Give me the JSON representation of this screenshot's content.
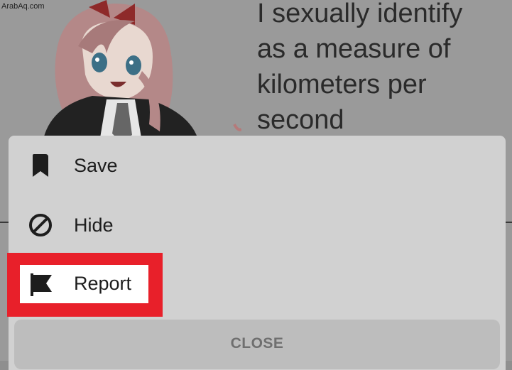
{
  "watermark": "ArabAq.com",
  "post": {
    "meme_text": "I sexually identify\nas a measure of\nkilometers per\nsecond"
  },
  "menu": {
    "items": [
      {
        "label": "Save",
        "icon": "bookmark-icon"
      },
      {
        "label": "Hide",
        "icon": "hide-icon"
      },
      {
        "label": "Report",
        "icon": "flag-icon"
      }
    ],
    "close_label": "CLOSE"
  },
  "colors": {
    "highlight": "#e8202a",
    "sheet": "#d1d1d1",
    "close_button": "#bdbdbd"
  }
}
